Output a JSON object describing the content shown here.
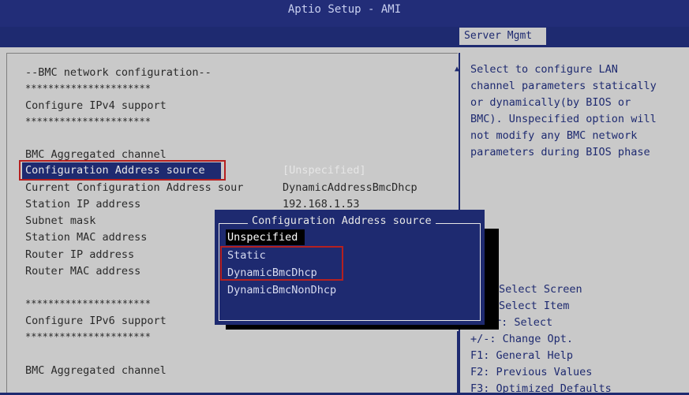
{
  "window": {
    "title": "Aptio Setup - AMI"
  },
  "tabs": [
    {
      "label": "Server Mgmt"
    }
  ],
  "settings": [
    {
      "label": "--BMC network configuration--"
    },
    {
      "label": "**********************"
    },
    {
      "label": "Configure IPv4 support"
    },
    {
      "label": "**********************"
    },
    {
      "label": "BMC Aggregated channel"
    },
    {
      "label": "Configuration Address source",
      "value": "[Unspecified]"
    },
    {
      "label": "Current Configuration Address sour",
      "value": "DynamicAddressBmcDhcp"
    },
    {
      "label": "Station IP address",
      "value": "192.168.1.53"
    },
    {
      "label": "Subnet mask"
    },
    {
      "label": "Station MAC address"
    },
    {
      "label": "Router IP address"
    },
    {
      "label": "Router MAC address"
    },
    {
      "label": "**********************"
    },
    {
      "label": "Configure IPv6 support"
    },
    {
      "label": "**********************"
    },
    {
      "label": "BMC Aggregated channel"
    }
  ],
  "help": {
    "lines": [
      "Select to configure LAN",
      "channel parameters statically",
      "or dynamically(by BIOS or",
      "BMC). Unspecified option will",
      "not modify any BMC network",
      "parameters during BIOS phase"
    ]
  },
  "keys": [
    "Select Screen",
    "Select Item",
    "r: Select",
    "+/-: Change Opt.",
    "F1: General Help",
    "F2: Previous Values",
    "F3: Optimized Defaults"
  ],
  "popup": {
    "title": "Configuration Address source",
    "options": [
      {
        "label": "Unspecified",
        "selected": true
      },
      {
        "label": "Static"
      },
      {
        "label": "DynamicBmcDhcp"
      },
      {
        "label": "DynamicBmcNonDhcp"
      }
    ]
  },
  "colors": {
    "bios_blue": "#1e2a70",
    "panel_gray": "#c9c9c9",
    "highlight_red": "#b52020"
  }
}
